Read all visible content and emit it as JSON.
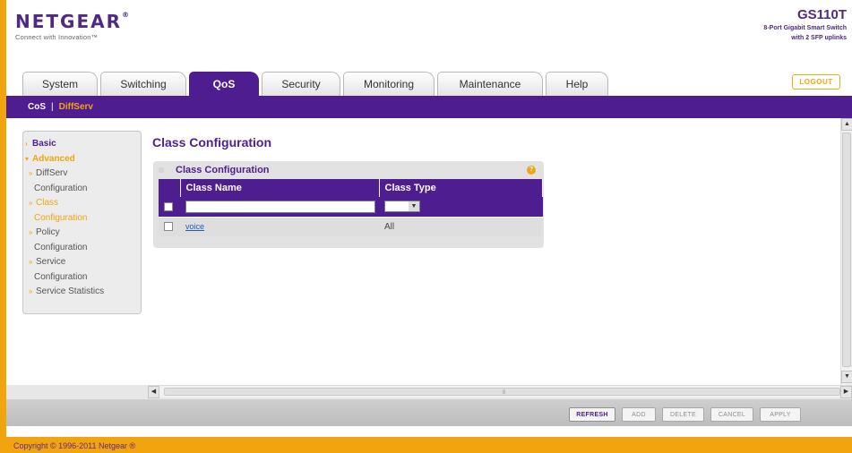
{
  "header": {
    "brand": "NETGEAR",
    "brand_mark": "®",
    "tagline": "Connect with Innovation™",
    "model": "GS110T",
    "description_line1": "8-Port Gigabit Smart Switch",
    "description_line2": "with 2 SFP uplinks",
    "logout_label": "LOGOUT"
  },
  "tabs": [
    {
      "label": "System",
      "active": false
    },
    {
      "label": "Switching",
      "active": false
    },
    {
      "label": "QoS",
      "active": true
    },
    {
      "label": "Security",
      "active": false
    },
    {
      "label": "Monitoring",
      "active": false
    },
    {
      "label": "Maintenance",
      "active": false
    },
    {
      "label": "Help",
      "active": false
    }
  ],
  "subnav": {
    "cos": "CoS",
    "separator": "|",
    "diffserv": "DiffServ"
  },
  "leftnav": {
    "basic": "Basic",
    "advanced": "Advanced",
    "diffserv_1": "DiffServ",
    "diffserv_2": "Configuration",
    "class_1": "Class",
    "class_2": "Configuration",
    "policy_1": "Policy",
    "policy_2": "Configuration",
    "service_1": "Service",
    "service_2": "Configuration",
    "service_stats": "Service Statistics"
  },
  "main": {
    "page_title": "Class Configuration",
    "panel_title": "Class Configuration",
    "help_glyph": "?",
    "columns": {
      "class_name": "Class Name",
      "class_type": "Class Type"
    },
    "input": {
      "class_name_value": "",
      "class_type_value": ""
    },
    "rows": [
      {
        "name": "voice",
        "type": "All"
      }
    ]
  },
  "buttons": {
    "refresh": "REFRESH",
    "add": "ADD",
    "delete": "DELETE",
    "cancel": "CANCEL",
    "apply": "APPLY"
  },
  "footer": {
    "copyright": "Copyright © 1996-2011 Netgear ®"
  },
  "colors": {
    "purple": "#4e1d8f",
    "orange": "#f2a40f"
  }
}
